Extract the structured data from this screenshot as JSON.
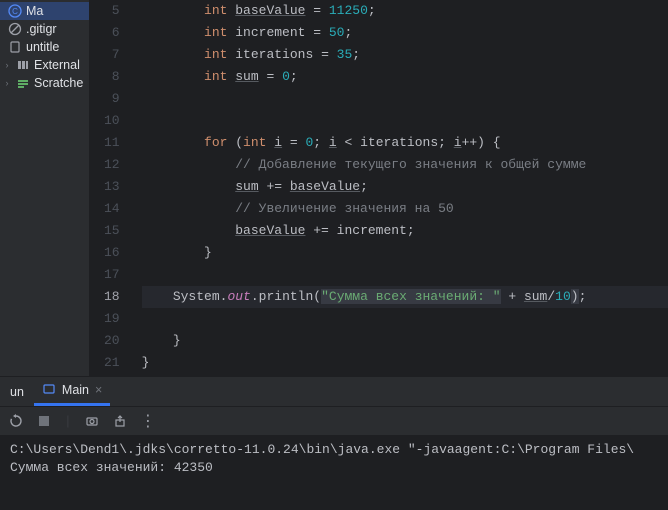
{
  "sidebar": {
    "items": [
      {
        "label": "Ma",
        "icon": "class-icon"
      },
      {
        "label": ".gitigr",
        "icon": "ignore-icon"
      },
      {
        "label": "untitle",
        "icon": "file-icon"
      },
      {
        "label": "External",
        "icon": "library-icon"
      },
      {
        "label": "Scratche",
        "icon": "scratch-icon"
      }
    ]
  },
  "editor": {
    "line_start": 5,
    "current_line": 18,
    "tokens": {
      "kw_int": "int",
      "kw_for": "for",
      "id_baseValue": "baseValue",
      "id_increment": "increment",
      "id_iterations": "iterations",
      "id_sum": "sum",
      "id_i": "i",
      "n_11250": "11250",
      "n_50": "50",
      "n_35": "35",
      "n_0": "0",
      "n_10": "10",
      "cmt1": "// Добавление текущего значения к общей сумме",
      "cmt2": "// Увеличение значения на 50",
      "sys": "System",
      "out": "out",
      "println": "println",
      "str1": "\"Сумма всех значений: \""
    }
  },
  "run": {
    "label": "un",
    "tab": "Main",
    "toolbar": {
      "rerun": "↻",
      "stop": "■",
      "more": "⋮"
    },
    "output_line1": "C:\\Users\\Dend1\\.jdks\\corretto-11.0.24\\bin\\java.exe \"-javaagent:C:\\Program Files\\",
    "output_line2": "Сумма всех значений: 42350"
  }
}
